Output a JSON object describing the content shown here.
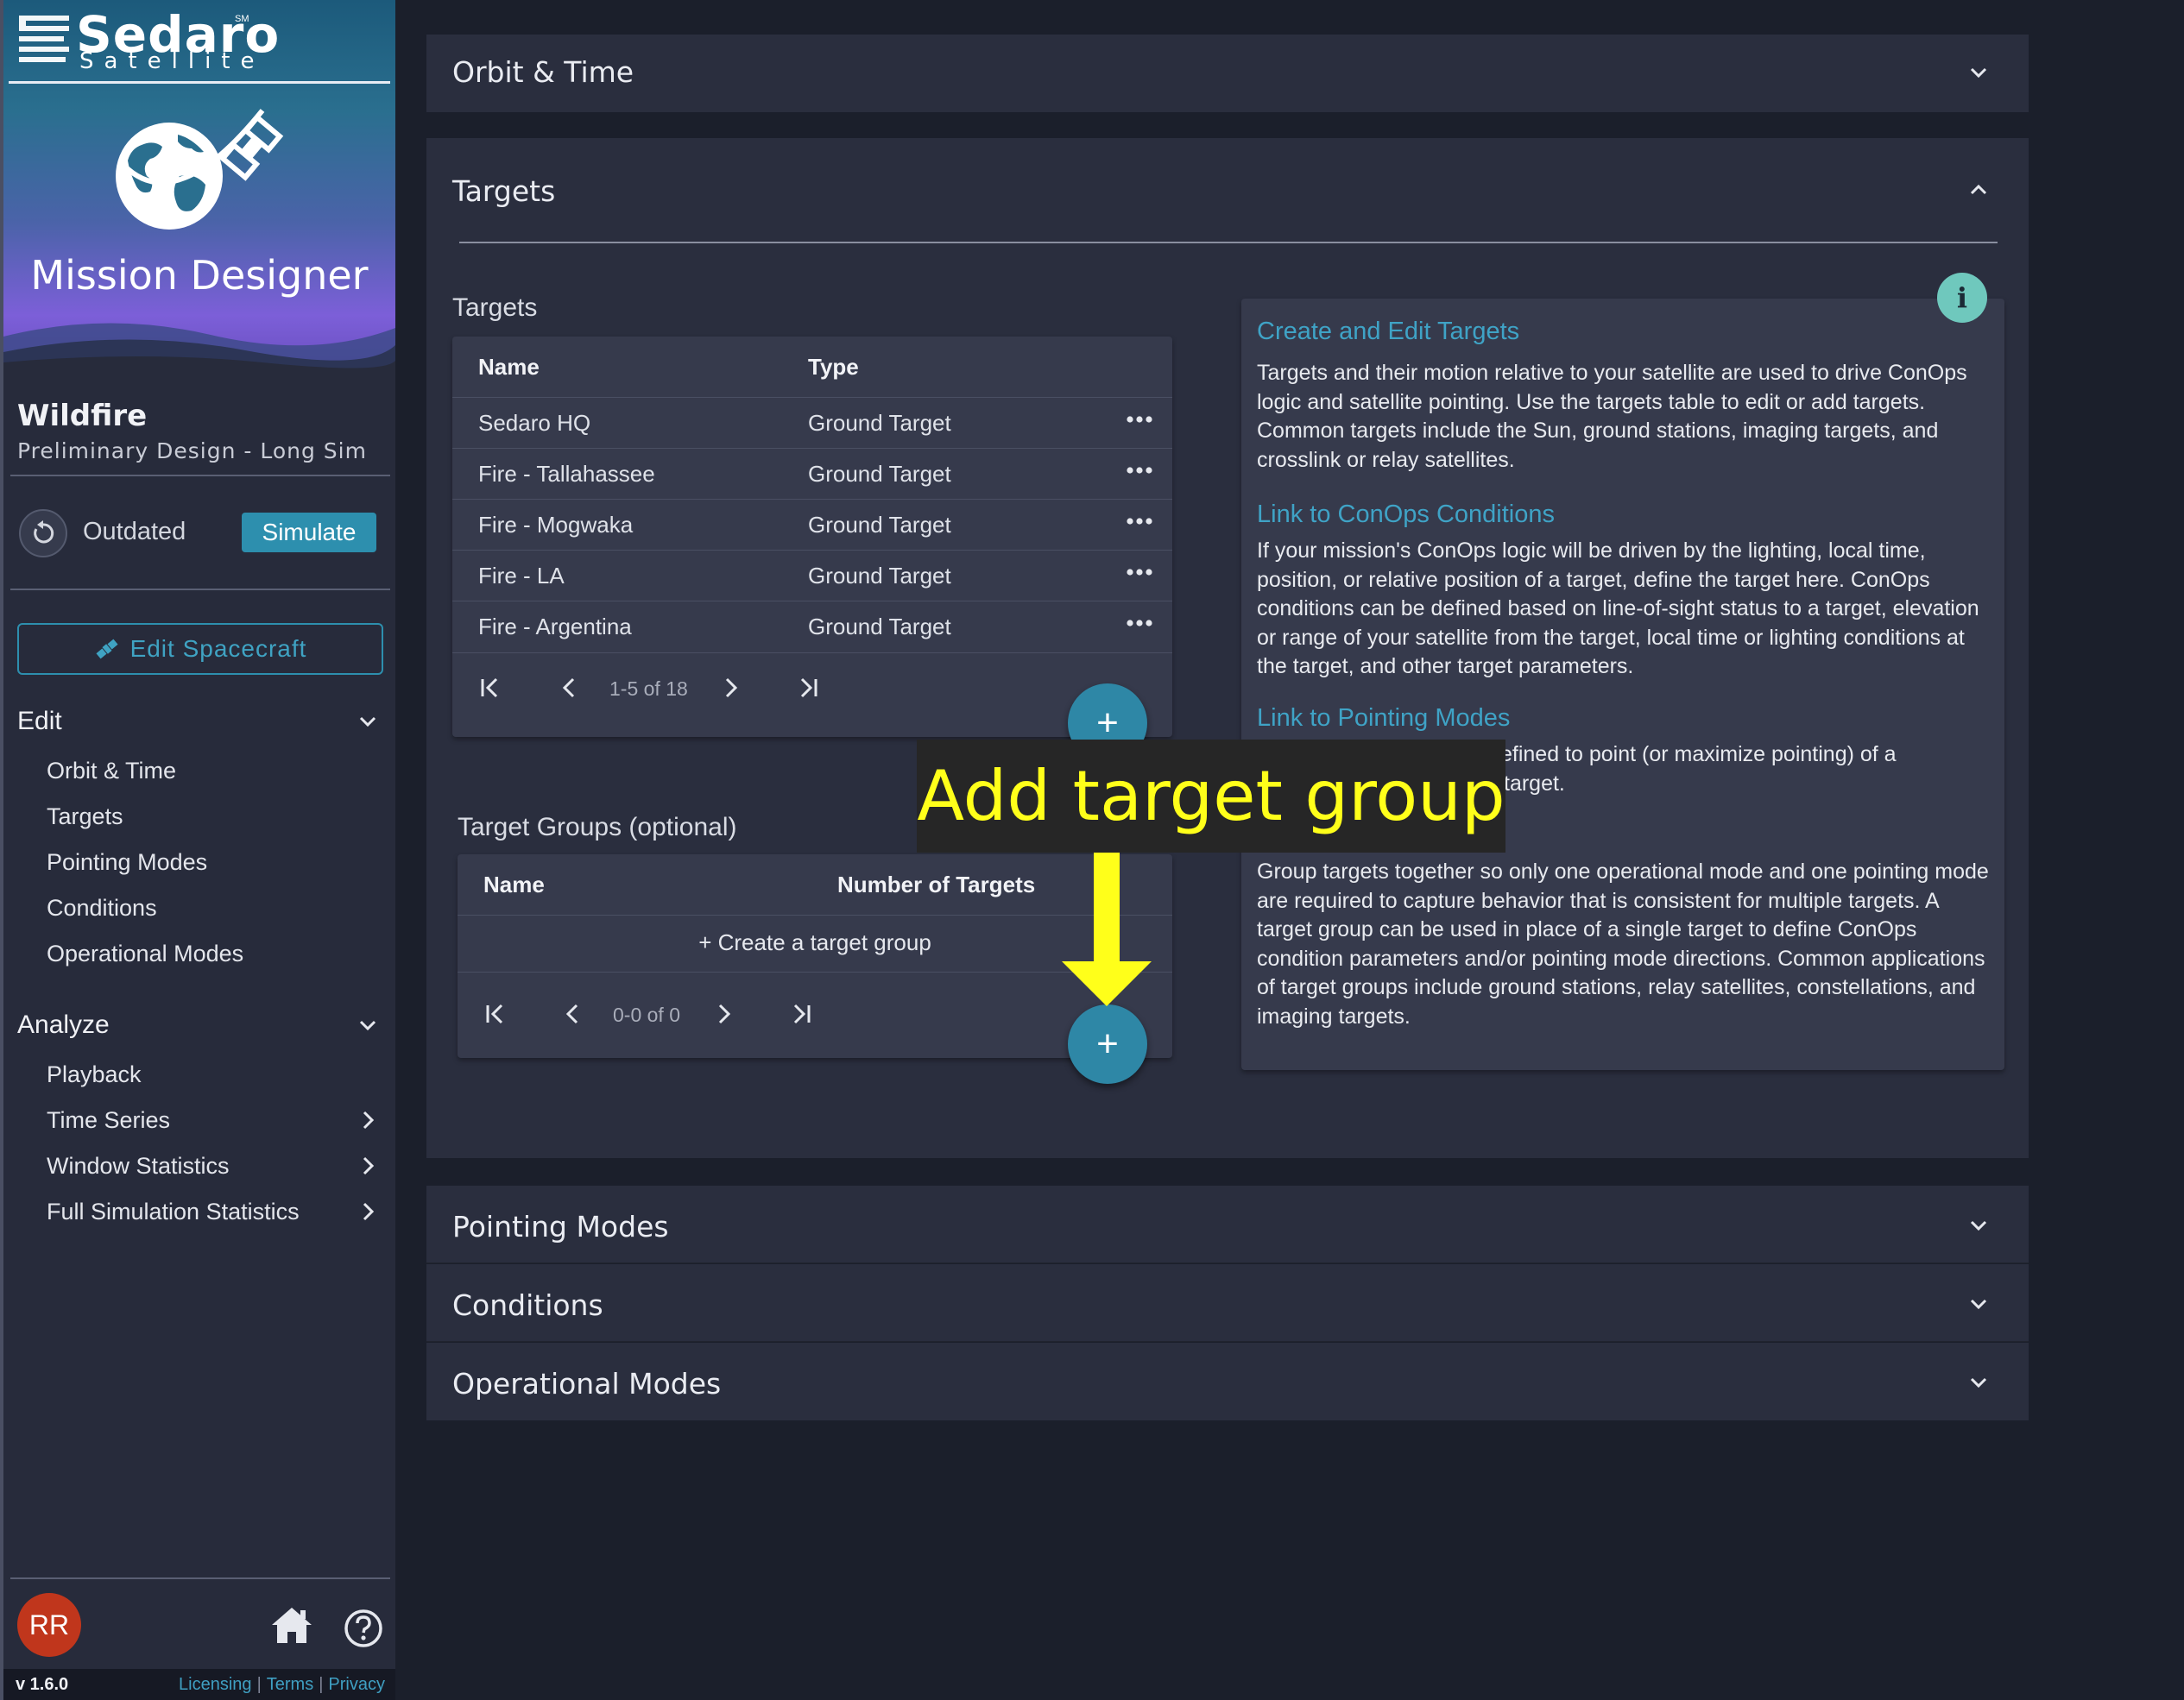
{
  "brand": {
    "name": "Sedaro",
    "sub": "Satellite",
    "sm": "SM",
    "app_title": "Mission Designer"
  },
  "project": {
    "name": "Wildfire",
    "subtitle": "Preliminary Design - Long Sim",
    "status": "Outdated",
    "simulate_label": "Simulate",
    "edit_spacecraft_label": "Edit Spacecraft"
  },
  "nav": {
    "edit": {
      "label": "Edit",
      "items": [
        "Orbit & Time",
        "Targets",
        "Pointing Modes",
        "Conditions",
        "Operational Modes"
      ]
    },
    "analyze": {
      "label": "Analyze",
      "items": [
        "Playback",
        "Time Series",
        "Window Statistics",
        "Full Simulation Statistics"
      ]
    }
  },
  "user": {
    "initials": "RR"
  },
  "footer": {
    "version": "v 1.6.0",
    "licensing": "Licensing",
    "terms": "Terms",
    "privacy": "Privacy"
  },
  "panels": {
    "orbit_time": "Orbit & Time",
    "targets": "Targets",
    "pointing_modes": "Pointing Modes",
    "conditions": "Conditions",
    "operational_modes": "Operational Modes"
  },
  "targets_table": {
    "label": "Targets",
    "columns": [
      "Name",
      "Type"
    ],
    "rows": [
      {
        "name": "Sedaro HQ",
        "type": "Ground Target"
      },
      {
        "name": "Fire - Tallahassee",
        "type": "Ground Target"
      },
      {
        "name": "Fire - Mogwaka",
        "type": "Ground Target"
      },
      {
        "name": "Fire - LA",
        "type": "Ground Target"
      },
      {
        "name": "Fire - Argentina",
        "type": "Ground Target"
      }
    ],
    "pagination": "1-5 of 18"
  },
  "target_groups_table": {
    "label": "Target Groups (optional)",
    "columns": [
      "Name",
      "Number of Targets"
    ],
    "create_label": "+ Create a target group",
    "pagination": "0-0 of 0"
  },
  "info": {
    "title1": "Create and Edit Targets",
    "body1": "Targets and their motion relative to your satellite are used to drive ConOps logic and satellite pointing. Use the targets table to edit or add targets. Common targets include the Sun, ground stations, imaging targets, and crosslink or relay satellites.",
    "title2": "Link to ConOps Conditions",
    "body2": "If your mission's ConOps logic will be driven by the lighting, local time, position, or relative position of a target, define the target here. ConOps conditions can be defined based on line-of-sight status to a target, elevation or range of your satellite from the target, local time or lighting conditions at the target, and other target parameters.",
    "title3": "Link to Pointing Modes",
    "body3a": "efined to point (or maximize pointing) of a",
    "body3b": "target.",
    "body4": "Group targets together so only one operational mode and one pointing mode are required to capture behavior that is consistent for multiple targets. A target group can be used in place of a single target to define ConOps condition parameters and/or pointing mode directions. Common applications of target groups include ground stations, relay satellites, constellations, and imaging targets."
  },
  "annotation": {
    "text": "Add target group"
  },
  "fab_symbol": "+",
  "colors": {
    "accent": "#2d8fae",
    "link": "#3fa3c6",
    "annotation": "#ffff1a",
    "avatar": "#c0361c"
  }
}
